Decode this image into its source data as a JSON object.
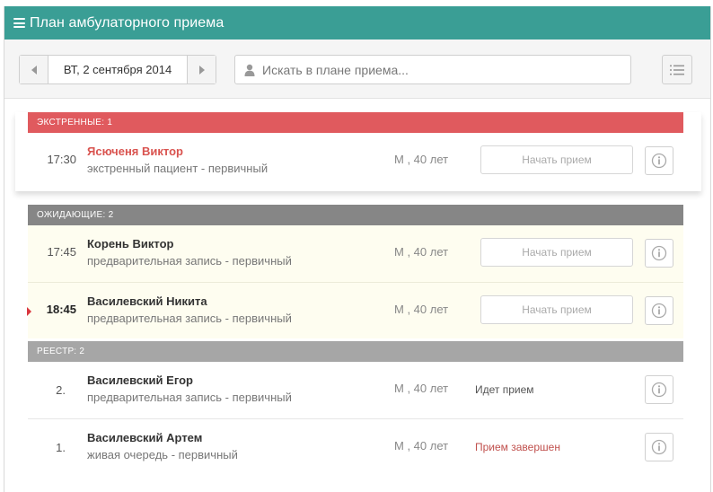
{
  "app": {
    "title": "План амбулаторного приема"
  },
  "toolbar": {
    "date": "ВТ, 2 сентября 2014",
    "search_placeholder": "Искать в плане приема..."
  },
  "sections": {
    "emergency": {
      "label": "ЭКСТРЕННЫЕ: 1",
      "rows": [
        {
          "time": "17:30",
          "name": "Ясюченя Виктор",
          "subtitle": "экстренный пациент - первичный",
          "demo": "М , 40 лет",
          "action": "Начать прием"
        }
      ]
    },
    "waiting": {
      "label": "ОЖИДАЮЩИЕ: 2",
      "rows": [
        {
          "time": "17:45",
          "name": "Корень Виктор",
          "subtitle": "предварительная запись - первичный",
          "demo": "М , 40 лет",
          "action": "Начать прием"
        },
        {
          "time": "18:45",
          "name": "Василевский Никита",
          "subtitle": "предварительная запись - первичный",
          "demo": "М , 40 лет",
          "action": "Начать прием"
        }
      ]
    },
    "registry": {
      "label": "РЕЕСТР: 2",
      "rows": [
        {
          "num": "2.",
          "name": "Василевский Егор",
          "subtitle": "предварительная запись - первичный",
          "demo": "М , 40 лет",
          "status": "Идет прием"
        },
        {
          "num": "1.",
          "name": "Василевский Артем",
          "subtitle": "живая очередь - первичный",
          "demo": "М , 40 лет",
          "status": "Прием завершен"
        }
      ]
    }
  },
  "colors": {
    "header_teal": "#3a9e95",
    "emergency_red": "#e05a5e",
    "waiting_gray": "#868686",
    "registry_gray": "#a6a6a6",
    "waiting_row_bg": "#fefdf0",
    "status_done_red": "#c0504d"
  },
  "icons": {
    "menu": "hamburger-icon",
    "prev": "chevron-left-icon",
    "next": "chevron-right-icon",
    "search": "user-icon",
    "list": "list-icon",
    "info": "info-icon"
  }
}
